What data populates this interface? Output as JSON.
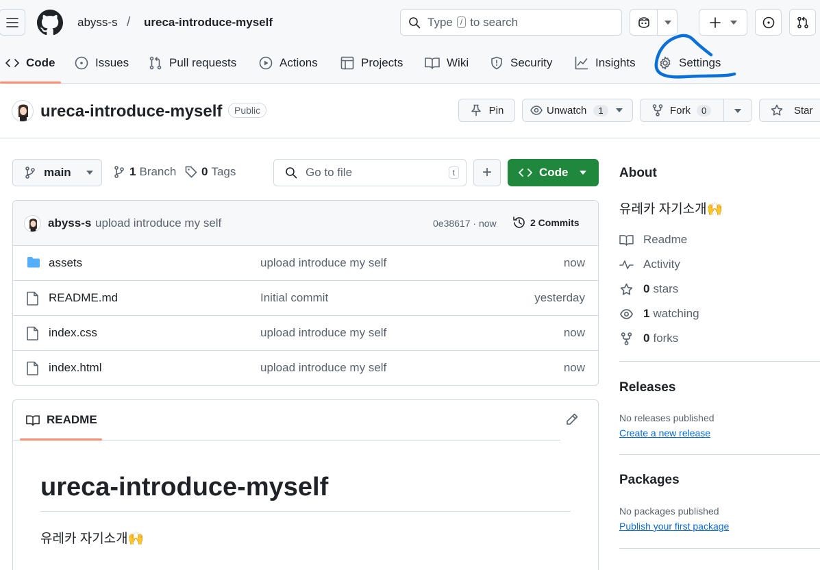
{
  "header": {
    "owner": "abyss-s",
    "separator": "/",
    "repo": "ureca-introduce-myself",
    "search_prefix": "Type",
    "search_key": "/",
    "search_suffix": "to search"
  },
  "tabs": [
    {
      "label": "Code",
      "icon": "code-icon"
    },
    {
      "label": "Issues",
      "icon": "issue-icon"
    },
    {
      "label": "Pull requests",
      "icon": "pull-request-icon"
    },
    {
      "label": "Actions",
      "icon": "play-icon"
    },
    {
      "label": "Projects",
      "icon": "table-icon"
    },
    {
      "label": "Wiki",
      "icon": "book-icon"
    },
    {
      "label": "Security",
      "icon": "shield-icon"
    },
    {
      "label": "Insights",
      "icon": "graph-icon"
    },
    {
      "label": "Settings",
      "icon": "gear-icon"
    }
  ],
  "annotation_color": "#0a6fd6",
  "repo_header": {
    "name": "ureca-introduce-myself",
    "visibility": "Public",
    "pin": "Pin",
    "unwatch": "Unwatch",
    "watch_count": "1",
    "fork": "Fork",
    "fork_count": "0",
    "star": "Star"
  },
  "toolbar": {
    "branch": "main",
    "branch_count": "1",
    "branch_label": "Branch",
    "tag_count": "0",
    "tag_label": "Tags",
    "goto_placeholder": "Go to file",
    "goto_key": "t",
    "add": "+",
    "code": "Code"
  },
  "latest_commit": {
    "author": "abyss-s",
    "message": "upload introduce my self",
    "hash_time": "0e38617 · now",
    "commits": "2 Commits"
  },
  "files": [
    {
      "name": "assets",
      "type": "folder",
      "message": "upload introduce my self",
      "age": "now"
    },
    {
      "name": "README.md",
      "type": "file",
      "message": "Initial commit",
      "age": "yesterday"
    },
    {
      "name": "index.css",
      "type": "file",
      "message": "upload introduce my self",
      "age": "now"
    },
    {
      "name": "index.html",
      "type": "file",
      "message": "upload introduce my self",
      "age": "now"
    }
  ],
  "readme": {
    "tab": "README",
    "title": "ureca-introduce-myself",
    "body": "유레카 자기소개🙌"
  },
  "about": {
    "heading": "About",
    "description": "유레카 자기소개🙌",
    "readme": "Readme",
    "activity": "Activity",
    "stars_count": "0",
    "stars": "stars",
    "watching_count": "1",
    "watching": "watching",
    "forks_count": "0",
    "forks": "forks"
  },
  "releases": {
    "heading": "Releases",
    "empty": "No releases published",
    "link": "Create a new release"
  },
  "packages": {
    "heading": "Packages",
    "empty": "No packages published",
    "link": "Publish your first package"
  },
  "colors": {
    "accent_green": "#1f883d",
    "link_blue": "#0969da",
    "tab_underline": "#fd8c73"
  }
}
